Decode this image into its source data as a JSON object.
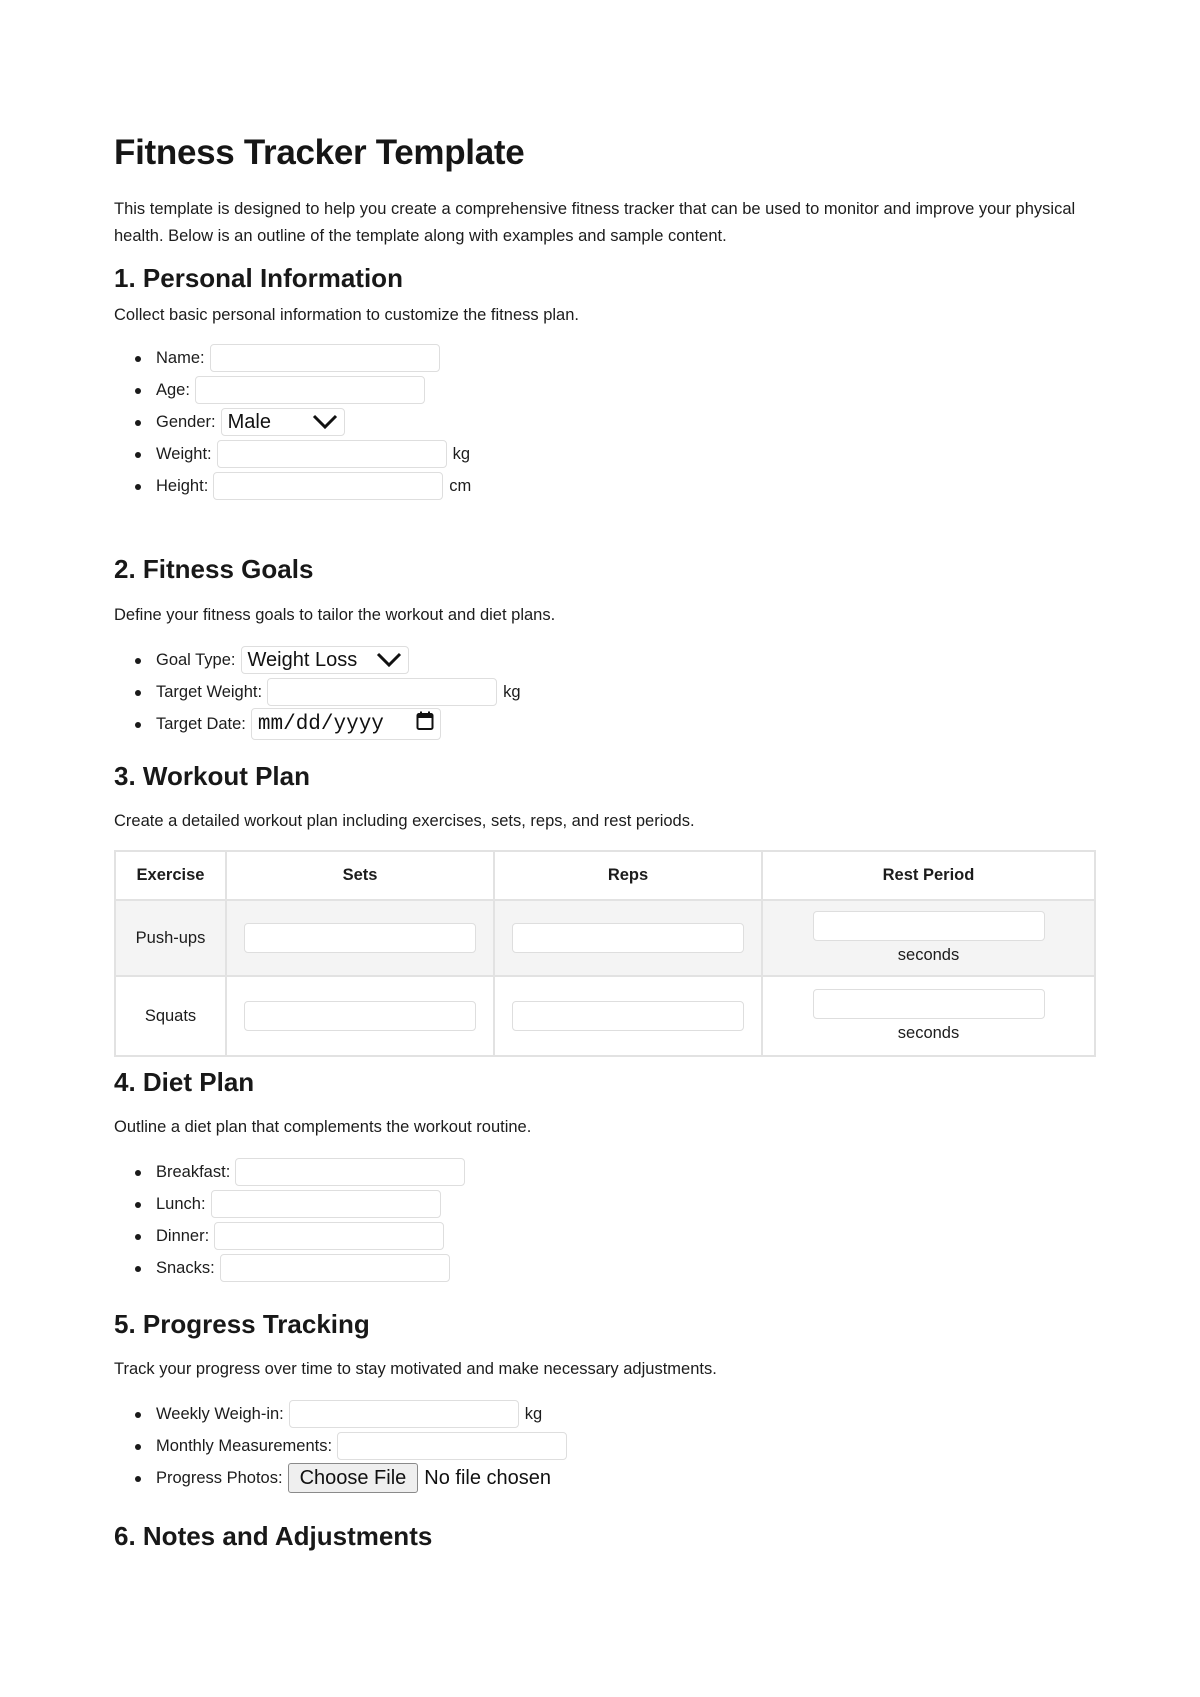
{
  "title": "Fitness Tracker Template",
  "intro": "This template is designed to help you create a comprehensive fitness tracker that can be used to monitor and improve your physical health. Below is an outline of the template along with examples and sample content.",
  "sections": {
    "personal": {
      "heading": "1. Personal Information",
      "description": "Collect basic personal information to customize the fitness plan.",
      "name_label": "Name:",
      "name_value": "",
      "age_label": "Age:",
      "age_value": "",
      "gender_label": "Gender:",
      "gender_selected": "Male",
      "weight_label": "Weight:",
      "weight_value": "",
      "weight_unit": "kg",
      "height_label": "Height:",
      "height_value": "",
      "height_unit": "cm"
    },
    "goals": {
      "heading": "2. Fitness Goals",
      "description": "Define your fitness goals to tailor the workout and diet plans.",
      "goal_type_label": "Goal Type:",
      "goal_type_selected": "Weight Loss",
      "target_weight_label": "Target Weight:",
      "target_weight_value": "",
      "target_weight_unit": "kg",
      "target_date_label": "Target Date:",
      "target_date_placeholder": "mm/dd/yyyy"
    },
    "workout": {
      "heading": "3. Workout Plan",
      "description": "Create a detailed workout plan including exercises, sets, reps, and rest periods.",
      "columns": [
        "Exercise",
        "Sets",
        "Reps",
        "Rest Period"
      ],
      "rows": [
        {
          "exercise": "Push-ups",
          "sets": "",
          "reps": "",
          "rest": "",
          "rest_unit": "seconds"
        },
        {
          "exercise": "Squats",
          "sets": "",
          "reps": "",
          "rest": "",
          "rest_unit": "seconds"
        }
      ]
    },
    "diet": {
      "heading": "4. Diet Plan",
      "description": "Outline a diet plan that complements the workout routine.",
      "breakfast_label": "Breakfast:",
      "lunch_label": "Lunch:",
      "dinner_label": "Dinner:",
      "snacks_label": "Snacks:"
    },
    "progress": {
      "heading": "5. Progress Tracking",
      "description": "Track your progress over time to stay motivated and make necessary adjustments.",
      "weigh_in_label": "Weekly Weigh-in:",
      "weigh_in_unit": "kg",
      "measurements_label": "Monthly Measurements:",
      "photos_label": "Progress Photos:",
      "choose_file_label": "Choose File",
      "file_status": "No file chosen"
    },
    "notes": {
      "heading": "6. Notes and Adjustments"
    }
  }
}
